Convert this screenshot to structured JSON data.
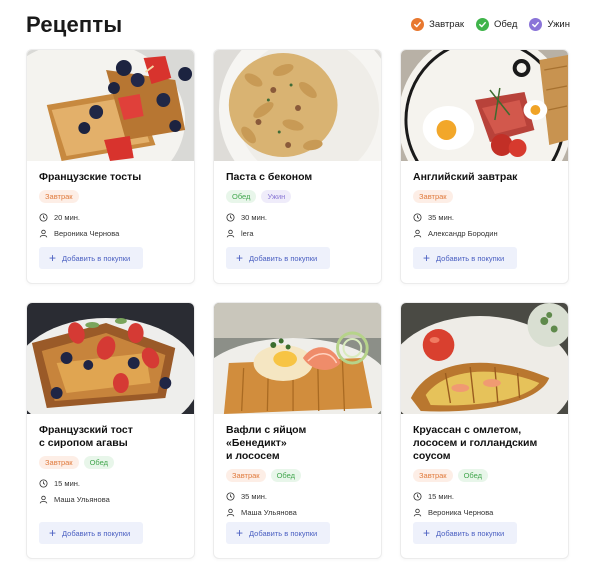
{
  "page_title": "Рецепты",
  "legend": [
    {
      "label": "Завтрак",
      "color": "#e8782f"
    },
    {
      "label": "Обед",
      "color": "#3fb44a"
    },
    {
      "label": "Ужин",
      "color": "#8a74d8"
    }
  ],
  "add_label": "Добавить в покупки",
  "recipes": [
    {
      "title": "Французские тосты",
      "tags": [
        "Завтрак"
      ],
      "time": "20 мин.",
      "author": "Вероника Чернова"
    },
    {
      "title": "Паста с беконом",
      "tags": [
        "Обед",
        "Ужин"
      ],
      "time": "30 мин.",
      "author": "lera"
    },
    {
      "title": "Английский завтрак",
      "tags": [
        "Завтрак"
      ],
      "time": "35 мин.",
      "author": "Александр Бородин"
    },
    {
      "title_lines": [
        "Французский тост",
        "с сиропом агавы"
      ],
      "tags": [
        "Завтрак",
        "Обед"
      ],
      "time": "15 мин.",
      "author": "Маша  Ульянова"
    },
    {
      "title_lines": [
        "Вафли с яйцом «Бенедикт»",
        "и лососем"
      ],
      "tags": [
        "Завтрак",
        "Обед"
      ],
      "time": "35 мин.",
      "author": "Маша  Ульянова"
    },
    {
      "title_lines": [
        "Круассан с омлетом,",
        "лососем и голландским",
        "соусом"
      ],
      "tags": [
        "Завтрак",
        "Обед"
      ],
      "time": "15 мин.",
      "author": "Вероника Чернова"
    }
  ]
}
